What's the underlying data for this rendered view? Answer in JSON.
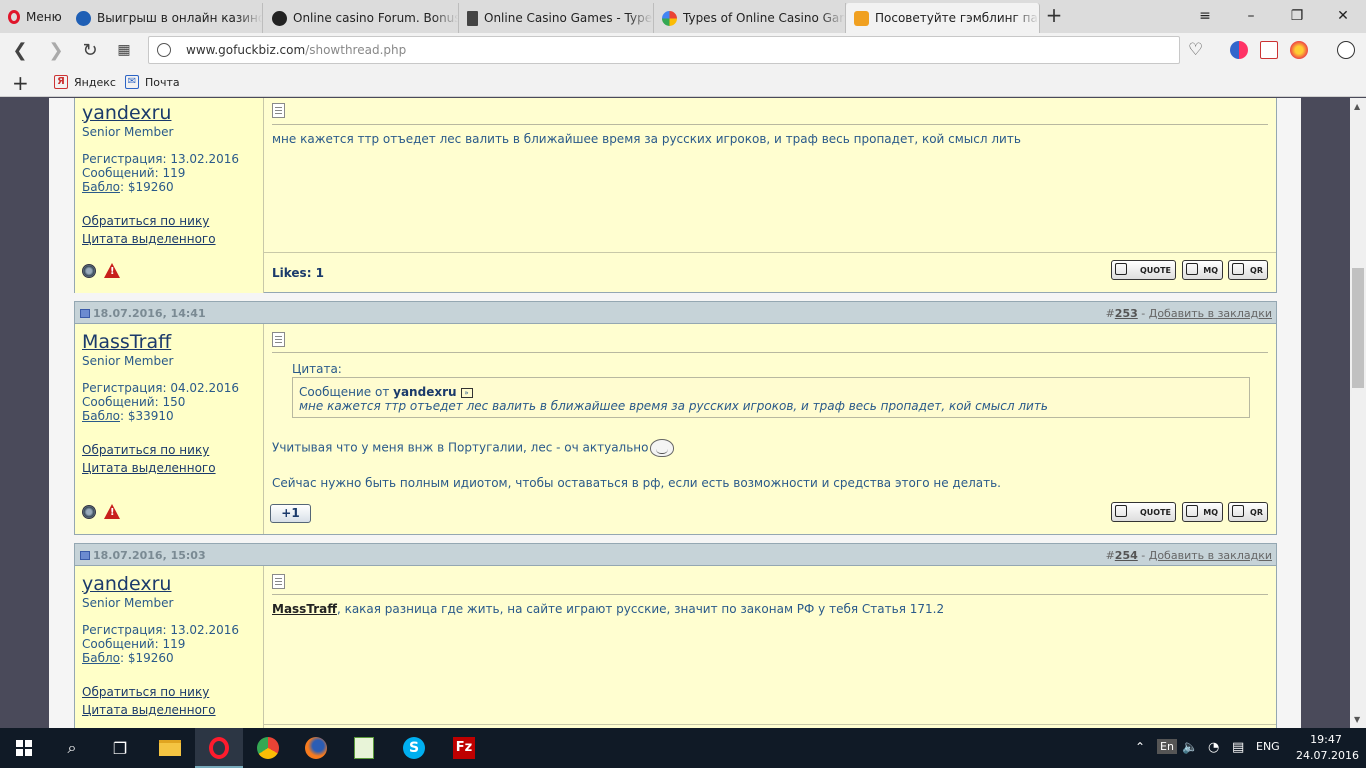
{
  "browser": {
    "menu_label": "Меню",
    "tabs": [
      {
        "label": "Выигрыш в онлайн казино",
        "fav_color": "#1f5fb5"
      },
      {
        "label": "Online casino Forum. Bonuse",
        "fav_color": "#222222"
      },
      {
        "label": "Online Casino Games - Types",
        "fav_color": "#444444"
      },
      {
        "label": "Types of Online Casino Game",
        "fav_color": "#4285f4"
      },
      {
        "label": "Посоветуйте гэмблинг парт",
        "fav_color": "#f0a020"
      }
    ],
    "url_host": "www.gofuckbiz.com",
    "url_path": "/showthread.php",
    "bookmarks": [
      {
        "label": "Яндекс",
        "icon": "Я"
      },
      {
        "label": "Почта",
        "icon": "✉"
      }
    ]
  },
  "posts": [
    {
      "username": "yandexru",
      "usertitle": "Senior Member",
      "reg": "Регистрация: 13.02.2016",
      "msgs": "Сообщений: 119",
      "money_label": "Бабло",
      "money_value": ": $19260",
      "link1": "Обратиться по нику",
      "link2": "Цитата выделенного",
      "text": "мне кажется ттр отъедет лес валить в ближайшее время за русских игроков, и траф весь пропадет, кой смысл лить",
      "likes": "Likes: 1"
    },
    {
      "date": "18.07.2016, 14:41",
      "number_prefix": "#",
      "number": "253",
      "bookmark_sep": " - ",
      "bookmark": "Добавить в закладки",
      "username": "MassTraff",
      "usertitle": "Senior Member",
      "reg": "Регистрация: 04.02.2016",
      "msgs": "Сообщений: 150",
      "money_label": "Бабло",
      "money_value": ": $33910",
      "link1": "Обратиться по нику",
      "link2": "Цитата выделенного",
      "quote_label": "Цитата:",
      "quote_from_prefix": "Сообщение от ",
      "quote_from": "yandexru",
      "quote_text": "мне кажется ттр отъедет лес валить в ближайшее время за русских игроков, и траф весь пропадет, кой смысл лить",
      "text1": "Учитывая что у меня внж в Португалии, лес - оч актуально",
      "text2": "Сейчас нужно быть полным идиотом, чтобы оставаться в рф, если есть возможности и средства этого не делать.",
      "plus_one": "+1"
    },
    {
      "date": "18.07.2016, 15:03",
      "number_prefix": "#",
      "number": "254",
      "bookmark_sep": " - ",
      "bookmark": "Добавить в закладки",
      "username": "yandexru",
      "usertitle": "Senior Member",
      "reg": "Регистрация: 13.02.2016",
      "msgs": "Сообщений: 119",
      "money_label": "Бабло",
      "money_value": ": $19260",
      "link1": "Обратиться по нику",
      "link2": "Цитата выделенного",
      "mention": "MassTraff",
      "text": ", какая разница где жить, на сайте играют русские, значит по законам РФ у тебя Статья 171.2"
    }
  ],
  "buttons": {
    "quote": "QUOTE",
    "mq": "MQ",
    "qr": "QR"
  },
  "taskbar": {
    "lang_input": "En",
    "lang": "ENG",
    "time": "19:47",
    "date": "24.07.2016"
  }
}
